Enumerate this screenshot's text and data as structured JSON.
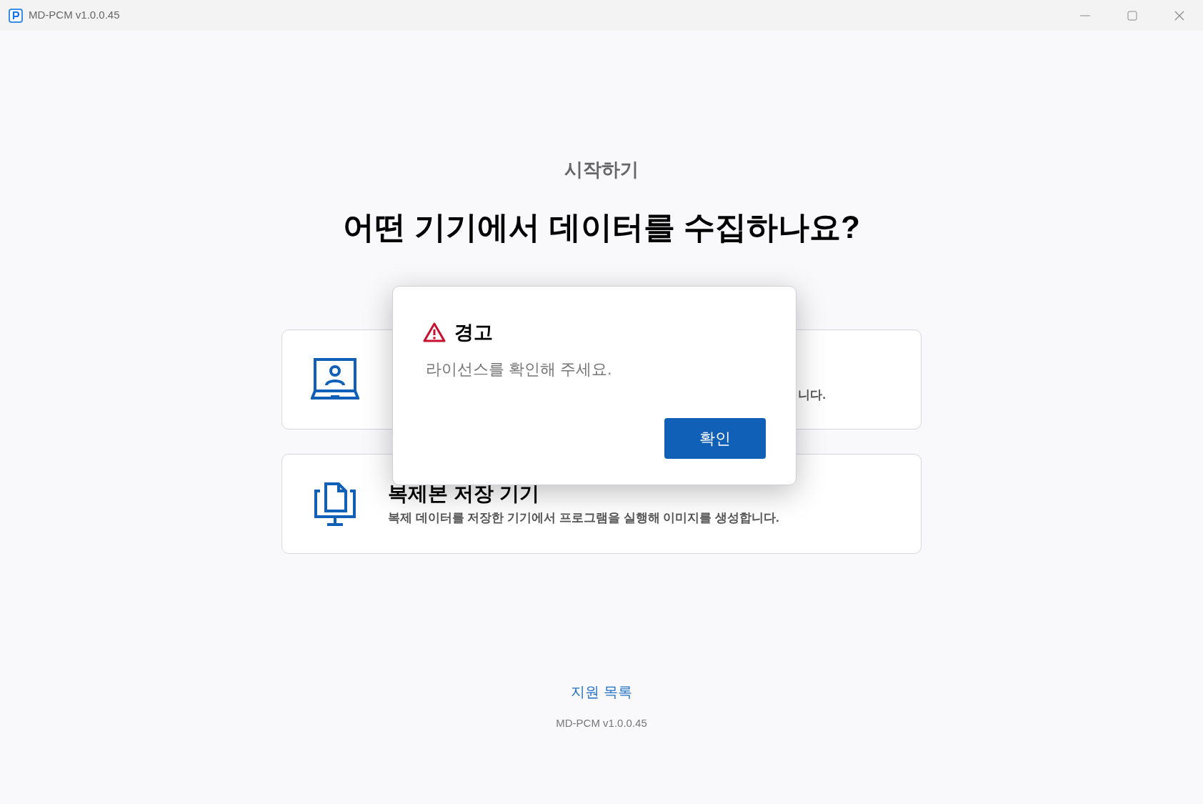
{
  "window": {
    "title": "MD-PCM v1.0.0.45"
  },
  "header": {
    "eyebrow": "시작하기",
    "heading": "어떤 기기에서 데이터를 수집하나요?"
  },
  "cards": [
    {
      "kind": "covered",
      "description": "니다."
    },
    {
      "kind": "full",
      "title": "복제본 저장 기기",
      "description": "복제 데이터를 저장한 기기에서 프로그램을 실행해 이미지를 생성합니다."
    }
  ],
  "footer": {
    "link": "지원 목록",
    "version": "MD-PCM v1.0.0.45"
  },
  "dialog": {
    "title": "경고",
    "message": "라이선스를 확인해 주세요.",
    "button": "확인"
  }
}
